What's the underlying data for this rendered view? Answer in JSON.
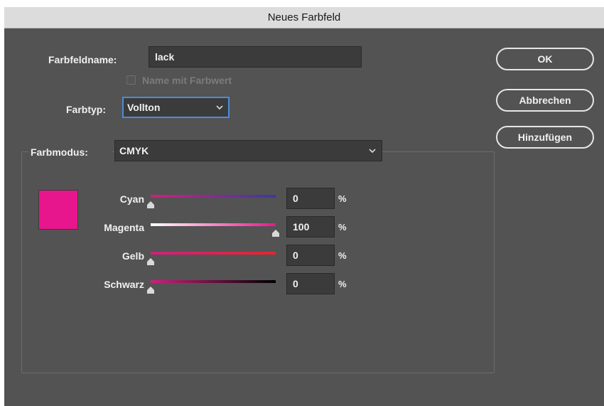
{
  "window": {
    "title": "Neues Farbfeld"
  },
  "form": {
    "name_label": "Farbfeldname:",
    "name_value": "lack",
    "name_with_value_label": "Name mit Farbwert",
    "name_with_value_checked": false,
    "type_label": "Farbtyp:",
    "type_value": "Vollton",
    "mode_label": "Farbmodus:",
    "mode_value": "CMYK"
  },
  "buttons": {
    "ok": "OK",
    "cancel": "Abbrechen",
    "add": "Hinzufügen"
  },
  "swatch_color": "#e8168c",
  "sliders": [
    {
      "label": "Cyan",
      "value": "0",
      "percent": 0,
      "unit": "%",
      "gradient": [
        "#d01f7e",
        "#3b3aa0"
      ]
    },
    {
      "label": "Magenta",
      "value": "100",
      "percent": 100,
      "unit": "%",
      "gradient": [
        "#ffffff",
        "#e8168c"
      ]
    },
    {
      "label": "Gelb",
      "value": "0",
      "percent": 0,
      "unit": "%",
      "gradient": [
        "#d01f7e",
        "#e5262d"
      ]
    },
    {
      "label": "Schwarz",
      "value": "0",
      "percent": 0,
      "unit": "%",
      "gradient": [
        "#d01f7e",
        "#000000"
      ]
    }
  ],
  "icons": {
    "dropdown": "chevron-down-icon",
    "slider_thumb": "slider-thumb-icon"
  },
  "colors": {
    "dialog_bg": "#535353",
    "field_bg": "#3b3b3b",
    "focus": "#4a8ed8"
  }
}
